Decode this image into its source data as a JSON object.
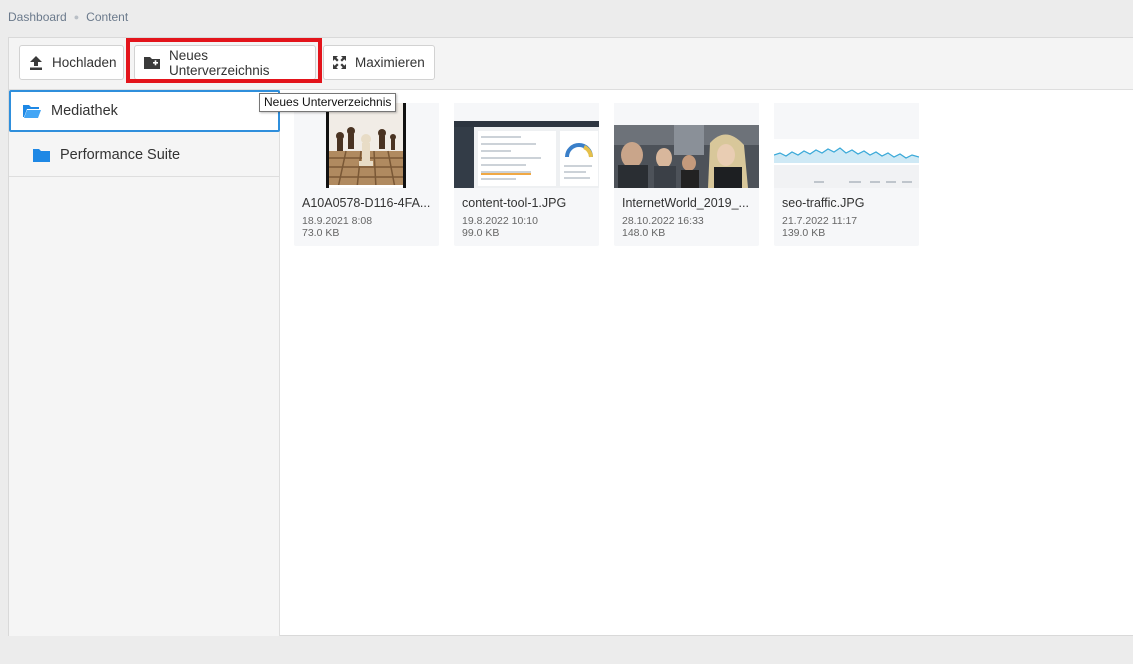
{
  "breadcrumb": {
    "items": [
      "Dashboard",
      "Content"
    ]
  },
  "toolbar": {
    "upload_label": "Hochladen",
    "new_dir_label": "Neues Unterverzeichnis",
    "maximize_label": "Maximieren"
  },
  "tooltip": {
    "text": "Neues Unterverzeichnis"
  },
  "sidebar": {
    "items": [
      {
        "label": "Mediathek",
        "icon": "folder-open-icon"
      },
      {
        "label": "Performance Suite",
        "icon": "folder-icon"
      }
    ]
  },
  "files": [
    {
      "name": "A10A0578-D116-4FA...",
      "date": "18.9.2021 8:08",
      "size": "73.0 KB"
    },
    {
      "name": "content-tool-1.JPG",
      "date": "19.8.2022 10:10",
      "size": "99.0 KB"
    },
    {
      "name": "InternetWorld_2019_...",
      "date": "28.10.2022 16:33",
      "size": "148.0 KB"
    },
    {
      "name": "seo-traffic.JPG",
      "date": "21.7.2022 11:17",
      "size": "139.0 KB"
    }
  ],
  "colors": {
    "accent": "#2f8fdc",
    "highlight": "#e3141b",
    "folder": "#1e88e5"
  }
}
